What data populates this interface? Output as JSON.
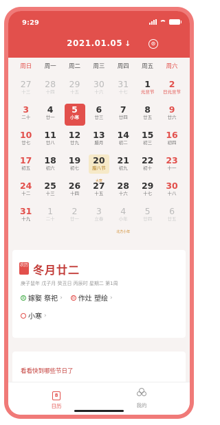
{
  "status": {
    "time": "9:29"
  },
  "header": {
    "date": "2021.01.05",
    "arrow": "↓",
    "today_icon": "⊙"
  },
  "weekdays": [
    "周日",
    "周一",
    "周二",
    "周三",
    "周四",
    "周五",
    "周六"
  ],
  "calendar": {
    "days": [
      {
        "d": "27",
        "l": "十三"
      },
      {
        "d": "28",
        "l": "十四"
      },
      {
        "d": "29",
        "l": "十五"
      },
      {
        "d": "30",
        "l": "十六"
      },
      {
        "d": "31",
        "l": "十七"
      },
      {
        "d": "1",
        "l": "元旦节"
      },
      {
        "d": "2",
        "l": "日元旦节"
      },
      {
        "d": "3",
        "l": "二十"
      },
      {
        "d": "4",
        "l": "廿一"
      },
      {
        "d": "5",
        "l": "小寒"
      },
      {
        "d": "6",
        "l": "廿三"
      },
      {
        "d": "7",
        "l": "廿四"
      },
      {
        "d": "8",
        "l": "廿五"
      },
      {
        "d": "9",
        "l": "廿六"
      },
      {
        "d": "10",
        "l": "廿七"
      },
      {
        "d": "11",
        "l": "廿八"
      },
      {
        "d": "12",
        "l": "廿九"
      },
      {
        "d": "13",
        "l": "腊月"
      },
      {
        "d": "14",
        "l": "初二"
      },
      {
        "d": "15",
        "l": "初三"
      },
      {
        "d": "16",
        "l": "初四"
      },
      {
        "d": "17",
        "l": "初五"
      },
      {
        "d": "18",
        "l": "初六"
      },
      {
        "d": "19",
        "l": "初七"
      },
      {
        "d": "20",
        "l": "腊八节",
        "tag": "大寒"
      },
      {
        "d": "21",
        "l": "初九"
      },
      {
        "d": "22",
        "l": "初十"
      },
      {
        "d": "23",
        "l": "十一"
      },
      {
        "d": "24",
        "l": "十二"
      },
      {
        "d": "25",
        "l": "十三"
      },
      {
        "d": "26",
        "l": "十四"
      },
      {
        "d": "27",
        "l": "十五"
      },
      {
        "d": "28",
        "l": "十六"
      },
      {
        "d": "29",
        "l": "十七"
      },
      {
        "d": "30",
        "l": "十八"
      },
      {
        "d": "31",
        "l": "十九"
      },
      {
        "d": "1",
        "l": "二十"
      },
      {
        "d": "2",
        "l": "廿一"
      },
      {
        "d": "3",
        "l": "立春"
      },
      {
        "d": "4",
        "l": "小年",
        "tag": "北方小年"
      },
      {
        "d": "5",
        "l": "廿四"
      },
      {
        "d": "6",
        "l": "廿五"
      }
    ]
  },
  "detail": {
    "badge": "农历",
    "lunar_date": "冬月廿二",
    "ganzhi": "庚子鼠年 戊子月 癸丑日 丙辰时 星期二 第1周",
    "yi_icon": "宜",
    "yi": "嫁娶 祭祀",
    "ji_icon": "忌",
    "ji": "作灶 塑绘",
    "solar_term": "小寒",
    "chevron": "›"
  },
  "festival_link": "看看快到哪些节日了",
  "tabs": [
    {
      "label": "日历",
      "icon_text": "8"
    },
    {
      "label": "我的"
    }
  ],
  "colors": {
    "accent": "#e2504c",
    "frame": "#f07a78"
  }
}
